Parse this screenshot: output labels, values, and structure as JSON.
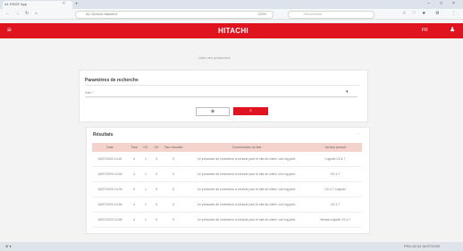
{
  "browser": {
    "tab_title": "A1 ENGF App",
    "tab_close": "×",
    "new_tab": "+",
    "win_min": "–",
    "win_max": "□",
    "win_close": "×",
    "nav_back": "←",
    "nav_forward": "→",
    "nav_reload": "↻",
    "nav_home": "⌂",
    "url": "A1 Service.hitachi.fr",
    "zoom": "100%",
    "search_placeholder": "Rechercher",
    "toolbar_icons": [
      "☆",
      "♡",
      "★",
      "⚙",
      "⋮"
    ]
  },
  "header": {
    "menu_icon": "≡",
    "logo": "HITACHI",
    "language": "FR",
    "user_icon": "♟",
    "bg_color": "#e0141e"
  },
  "breadcrumb": "Liste des protocoles",
  "params": {
    "title": "Paramètres de recherche",
    "field_label": "Site *",
    "field_icon": "▾",
    "clear_label": "⊗",
    "search_label": "⌕"
  },
  "results": {
    "title": "Résultats",
    "action_icon": "⋯",
    "columns": [
      "Date",
      "Total",
      "KO",
      "OK",
      "Taux réussite",
      "Commentaire du test",
      "Version produit"
    ],
    "rows": [
      [
        "16/07/2020 14:01",
        "4",
        "1",
        "3",
        "0",
        "Le protocole de connexion a échoué pour le site du client, voir log joint.",
        "Logiciel V2.4.7"
      ],
      [
        "16/07/2020 14:02",
        "4",
        "1",
        "3",
        "0",
        "Le protocole de connexion a échoué pour le site du client, voir log joint.",
        "V2.4.7"
      ],
      [
        "16/07/2020 14:03",
        "4",
        "1",
        "3",
        "0",
        "Le protocole de connexion a échoué pour le site du client, voir log joint.",
        "V2.4.7 Logiciel"
      ],
      [
        "16/07/2020 14:04",
        "4",
        "1",
        "3",
        "0",
        "Le protocole de connexion a échoué pour le site du client, voir log joint.",
        "V2.4.7"
      ],
      [
        "16/07/2020 14:05",
        "4",
        "1",
        "3",
        "0",
        "Le protocole de connexion a échoué pour le site du client, voir log joint.",
        "Version logiciel V2.4.7"
      ]
    ]
  },
  "statusbar": {
    "left": "⊕ ▾",
    "right": "FRA 10:34 16/07/2020"
  }
}
